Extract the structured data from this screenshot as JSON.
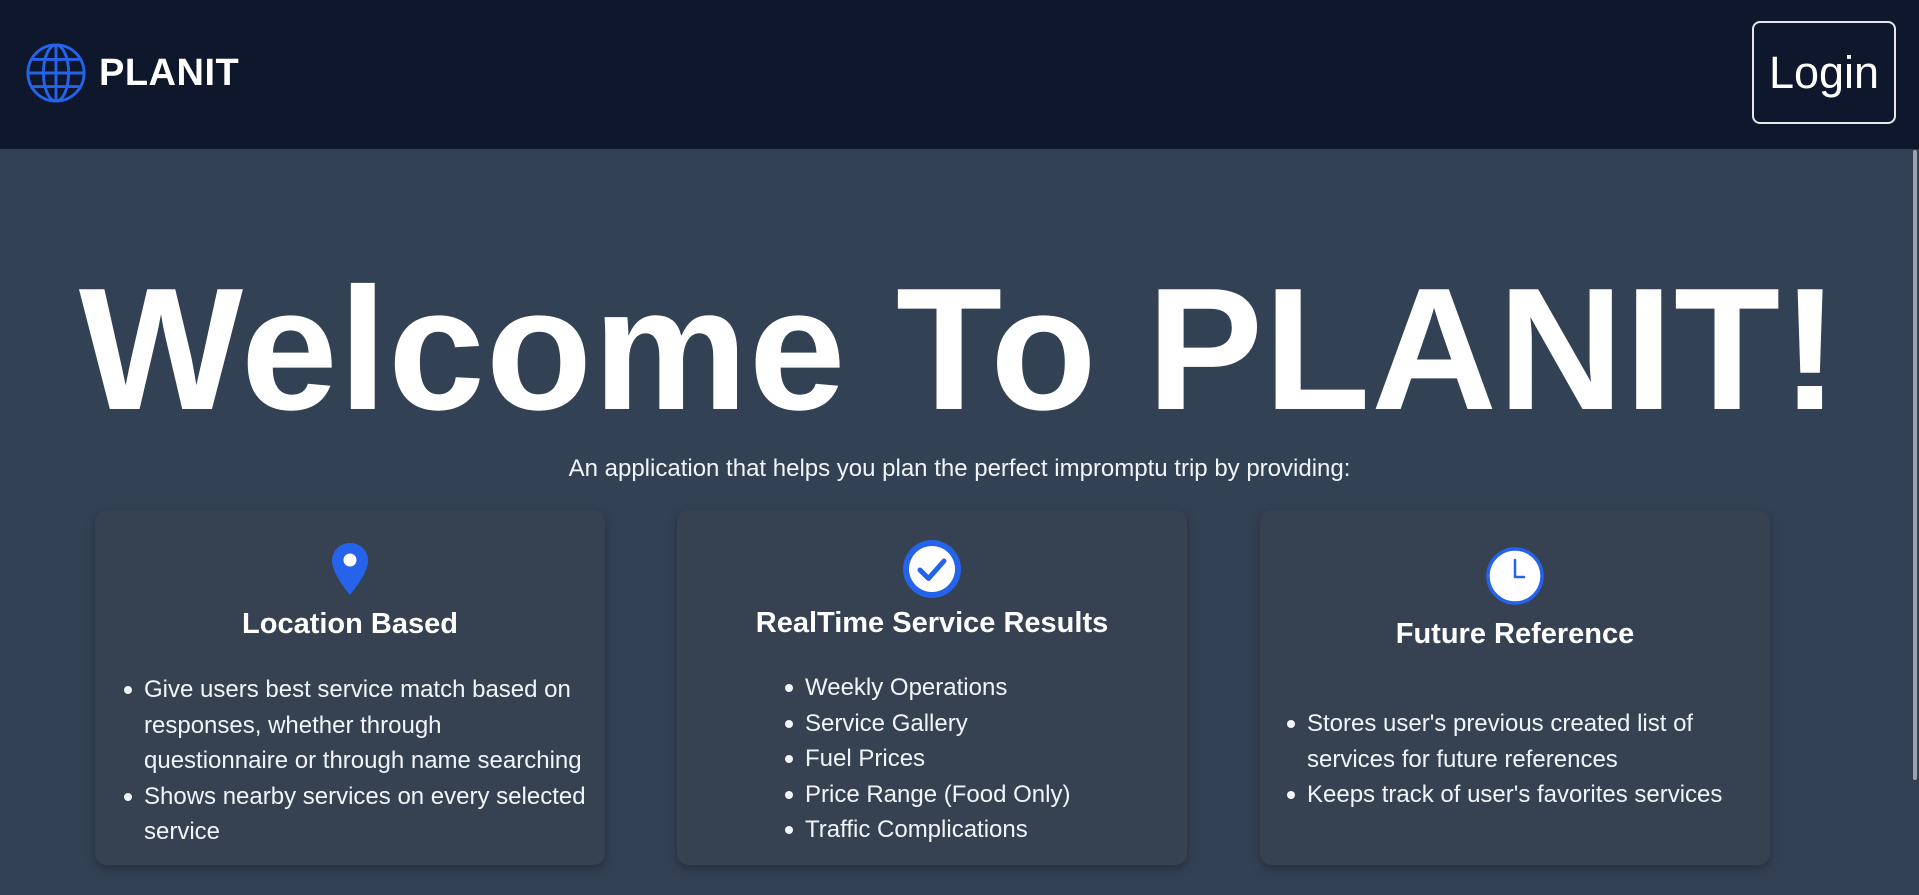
{
  "nav": {
    "brand": "PLANIT",
    "login_label": "Login"
  },
  "hero": {
    "title": "Welcome To PLANIT!",
    "subtitle": "An application that helps you plan the perfect impromptu trip by providing:"
  },
  "features": [
    {
      "icon": "map-pin-icon",
      "title": "Location Based",
      "items": [
        "Give users best service match based on responses, whether through questionnaire or through name searching",
        "Shows nearby services on every selected service"
      ]
    },
    {
      "icon": "check-circle-icon",
      "title": "RealTime Service Results",
      "items": [
        "Weekly Operations",
        "Service Gallery",
        "Fuel Prices",
        "Price Range (Food Only)",
        "Traffic Complications"
      ]
    },
    {
      "icon": "clock-icon",
      "title": "Future Reference",
      "items": [
        "Stores user's previous created list of services for future references",
        "Keeps track of user's favorites services"
      ]
    }
  ],
  "colors": {
    "nav_bg": "#0e172b",
    "page_bg": "#334155",
    "card_bg": "#364152",
    "accent": "#2563eb"
  }
}
